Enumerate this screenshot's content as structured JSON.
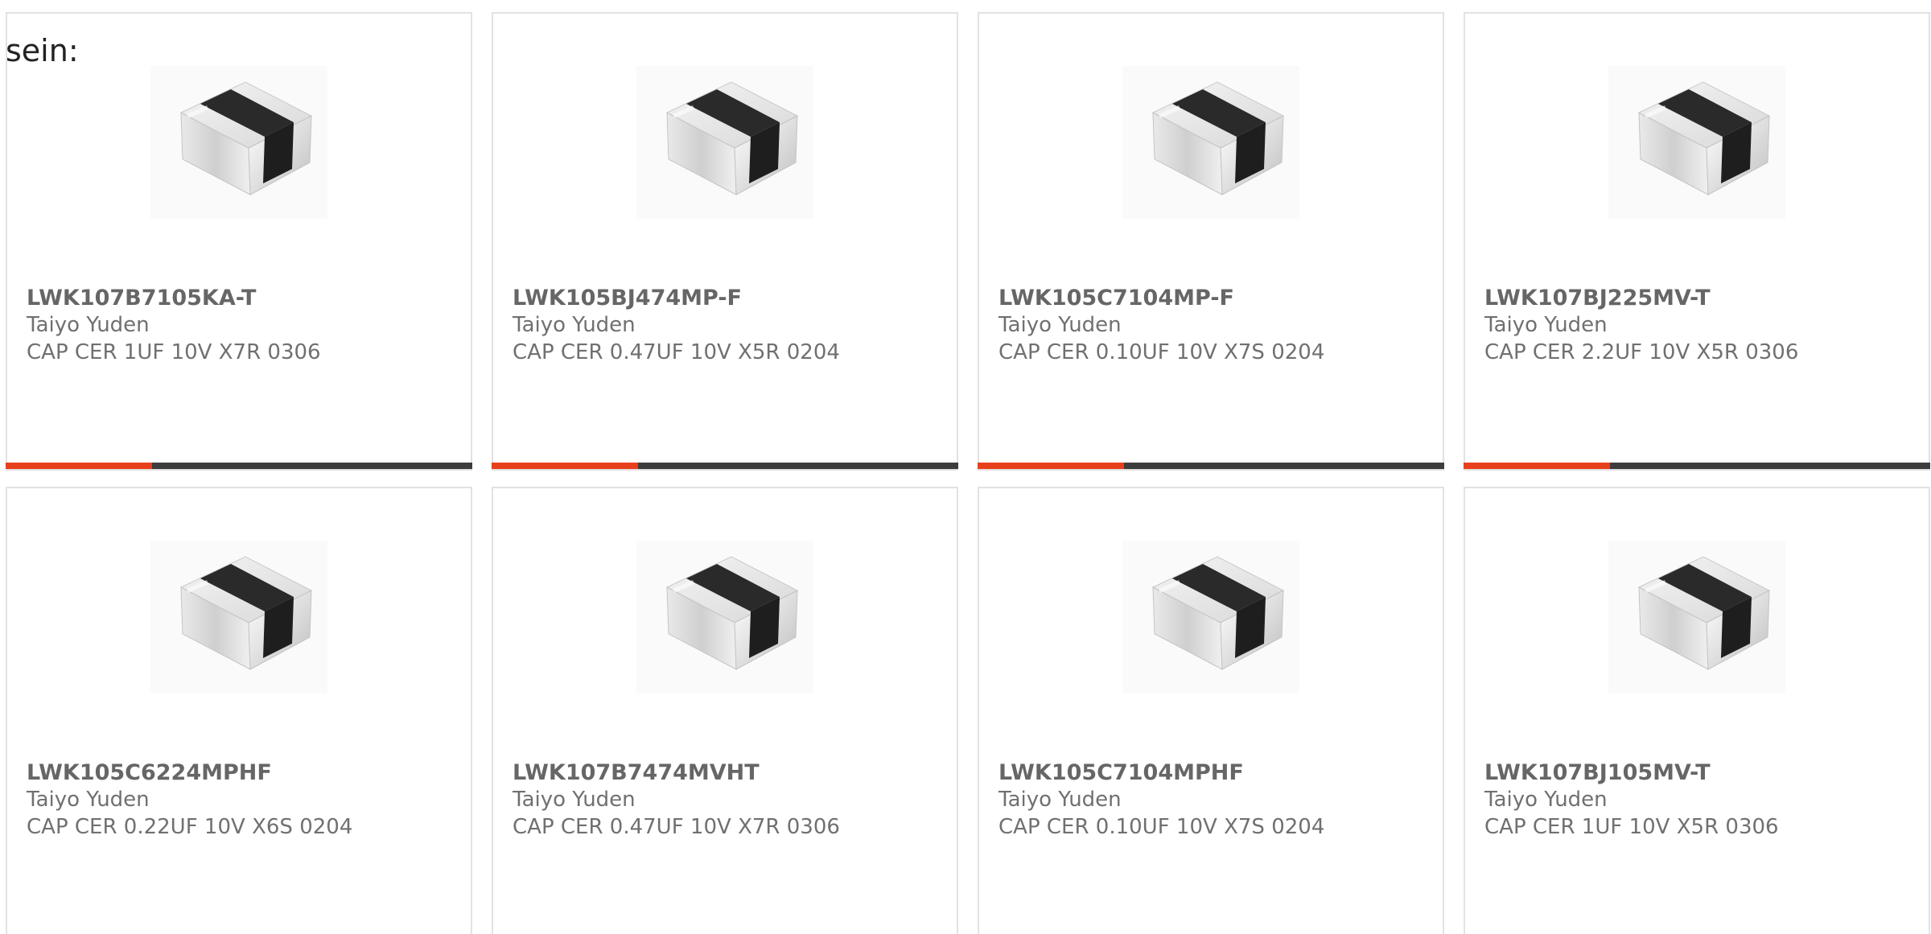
{
  "intro_text": "sein:",
  "colors": {
    "accent": "#e8401c",
    "bar_dark": "#3d3d3d",
    "border": "#e2e2e2"
  },
  "products": [
    {
      "part_number": "LWK107B7105KA-T",
      "manufacturer": "Taiyo Yuden",
      "description": "CAP CER 1UF 10V X7R 0306",
      "image_icon": "capacitor-chip-image"
    },
    {
      "part_number": "LWK105BJ474MP-F",
      "manufacturer": "Taiyo Yuden",
      "description": "CAP CER 0.47UF 10V X5R 0204",
      "image_icon": "capacitor-chip-image"
    },
    {
      "part_number": "LWK105C7104MP-F",
      "manufacturer": "Taiyo Yuden",
      "description": "CAP CER 0.10UF 10V X7S 0204",
      "image_icon": "capacitor-chip-image"
    },
    {
      "part_number": "LWK107BJ225MV-T",
      "manufacturer": "Taiyo Yuden",
      "description": "CAP CER 2.2UF 10V X5R 0306",
      "image_icon": "capacitor-chip-image"
    },
    {
      "part_number": "LWK105C6224MPHF",
      "manufacturer": "Taiyo Yuden",
      "description": "CAP CER 0.22UF 10V X6S 0204",
      "image_icon": "capacitor-chip-image"
    },
    {
      "part_number": "LWK107B7474MVHT",
      "manufacturer": "Taiyo Yuden",
      "description": "CAP CER 0.47UF 10V X7R 0306",
      "image_icon": "capacitor-chip-image"
    },
    {
      "part_number": "LWK105C7104MPHF",
      "manufacturer": "Taiyo Yuden",
      "description": "CAP CER 0.10UF 10V X7S 0204",
      "image_icon": "capacitor-chip-image"
    },
    {
      "part_number": "LWK107BJ105MV-T",
      "manufacturer": "Taiyo Yuden",
      "description": "CAP CER 1UF 10V X5R 0306",
      "image_icon": "capacitor-chip-image"
    }
  ]
}
